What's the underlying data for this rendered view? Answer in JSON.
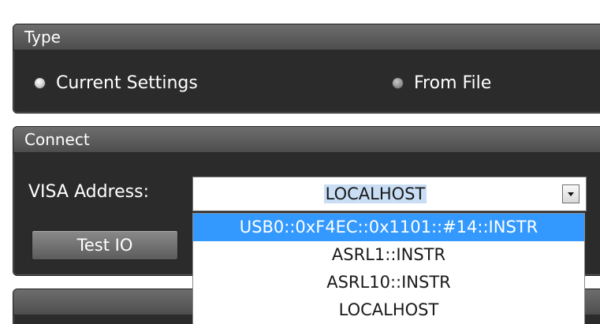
{
  "type_group": {
    "title": "Type",
    "options": [
      {
        "label": "Current Settings",
        "selected": true
      },
      {
        "label": "From File",
        "selected": false
      }
    ]
  },
  "connect_group": {
    "title": "Connect",
    "visa_label": "VISA Address:",
    "visa_value": "LOCALHOST",
    "test_button": "Test IO",
    "dropdown_items": [
      {
        "label": "USB0::0xF4EC::0x1101::#14::INSTR",
        "highlighted": true
      },
      {
        "label": "ASRL1::INSTR",
        "highlighted": false
      },
      {
        "label": "ASRL10::INSTR",
        "highlighted": false
      },
      {
        "label": "LOCALHOST",
        "highlighted": false
      }
    ]
  },
  "colors": {
    "panel_bg": "#2b2b2b",
    "header_bg": "#5e5e5e",
    "highlight": "#3399ff"
  }
}
